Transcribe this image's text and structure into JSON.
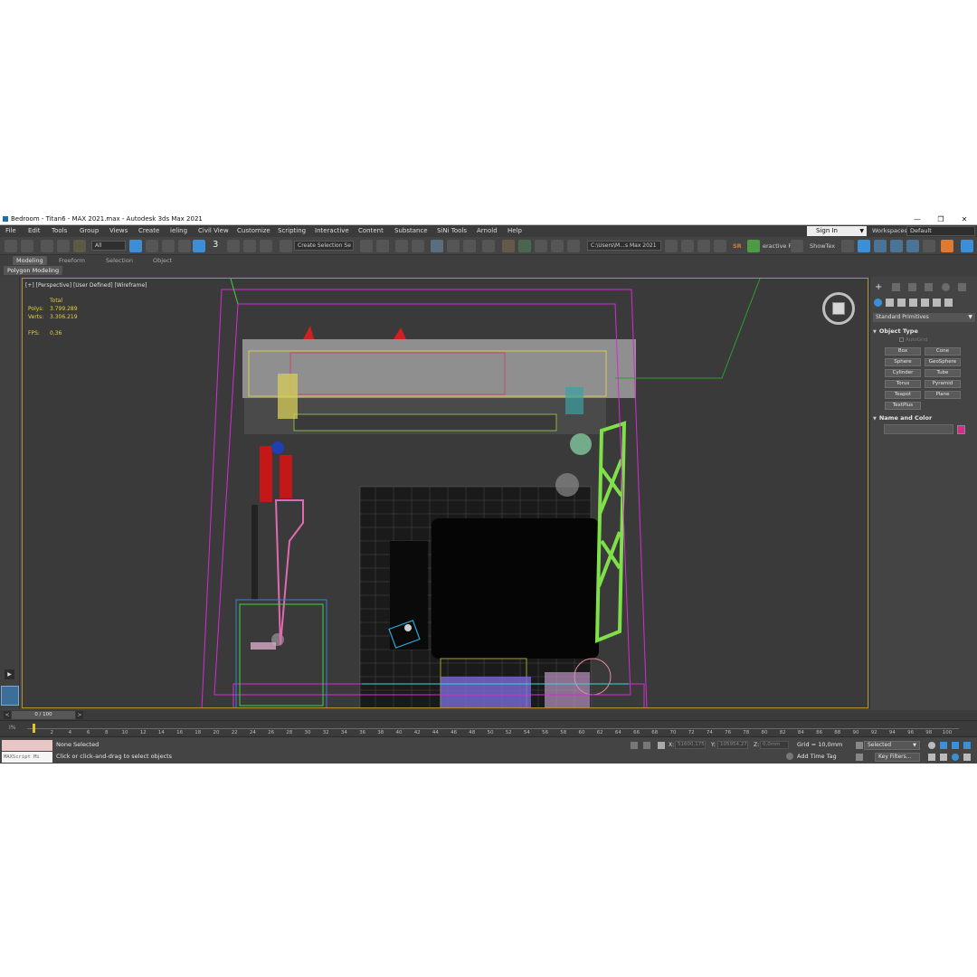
{
  "window": {
    "title": "Bedroom - Titan6 - MAX 2021.max - Autodesk 3ds Max 2021",
    "controls": [
      "—",
      "❐",
      "✕"
    ]
  },
  "menubar": {
    "items": [
      "File",
      "Edit",
      "Tools",
      "Group",
      "Views",
      "Create",
      "ieling",
      "Civil View",
      "Customize",
      "Scripting",
      "Interactive",
      "Content",
      "Substance",
      "SiNi Tools",
      "Arnold",
      "Help"
    ],
    "sign_in": "Sign In",
    "workspaces_label": "Workspaces:",
    "workspace_value": "Default"
  },
  "toolbar": {
    "filter_value": "All",
    "selection_set_placeholder": "Create Selection Se",
    "path_value": "C:\\Users\\M...s Max 2021",
    "sr_label": "SR",
    "interactive_label": "eractive Rε",
    "showtex_label": "ShowTex",
    "snap_number": "3",
    "accent_color": "#3c8fd6",
    "icons": [
      "undo-icon",
      "redo-icon",
      "link-icon",
      "unlink-icon",
      "bind-space-warp-icon",
      "select-object-icon",
      "select-by-name-icon",
      "rectangular-selection-icon",
      "window-crossing-icon",
      "select-move-icon",
      "select-rotate-icon",
      "select-scale-icon",
      "snap-toggle-icon",
      "angle-snap-icon",
      "percent-snap-icon",
      "spinner-snap-icon",
      "mirror-icon",
      "align-icon",
      "scene-explorer-icon",
      "layer-explorer-icon",
      "curve-editor-icon",
      "schematic-view-icon",
      "material-editor-icon",
      "render-setup-icon",
      "render-frame-icon",
      "render-icon",
      "render-production-icon"
    ]
  },
  "ribbon": {
    "tabs": [
      "Modeling",
      "Freeform",
      "Selection",
      "Object"
    ],
    "active_tab": "Modeling",
    "sub_label": "Polygon Modeling"
  },
  "viewport": {
    "label": "[+] [Perspective] [User Defined] [Wireframe]",
    "stats": {
      "total_label": "Total",
      "polys_label": "Polys:",
      "polys_value": "3.799.289",
      "verts_label": "Verts:",
      "verts_value": "3.306.219",
      "fps_label": "FPS:",
      "fps_value": "0,36"
    },
    "border_color": "#b08e3c"
  },
  "command_panel": {
    "category": "Standard Primitives",
    "object_type_title": "Object Type",
    "autogrid_label": "AutoGrid",
    "primitives": [
      "Box",
      "Cone",
      "Sphere",
      "GeoSphere",
      "Cylinder",
      "Tube",
      "Torus",
      "Pyramid",
      "Teapot",
      "Plane",
      "TextPlus"
    ],
    "name_color_title": "Name and Color",
    "object_color": "#d82a8c"
  },
  "timeline": {
    "frame_display": "0 / 100",
    "prev": "<",
    "next": ">",
    "ticks": [
      2,
      4,
      6,
      8,
      10,
      12,
      14,
      16,
      18,
      20,
      22,
      24,
      26,
      28,
      30,
      32,
      34,
      36,
      38,
      40,
      42,
      44,
      46,
      48,
      50,
      52,
      54,
      56,
      58,
      60,
      62,
      64,
      66,
      68,
      70,
      72,
      74,
      76,
      78,
      80,
      82,
      84,
      86,
      88,
      90,
      92,
      94,
      96,
      98,
      100
    ]
  },
  "status": {
    "maxscript_label": "MAXScript Mi",
    "selection_status": "None Selected",
    "prompt": "Click or click-and-drag to select objects",
    "x_label": "X:",
    "x_value": "51600,175",
    "y_label": "Y:",
    "y_value": "105954,27",
    "z_label": "Z:",
    "z_value": "0,0mm",
    "grid": "Grid = 10,0mm",
    "add_time_tag": "Add Time Tag",
    "selected_dropdown": "Selected",
    "key_filters": "Key Filters..."
  }
}
